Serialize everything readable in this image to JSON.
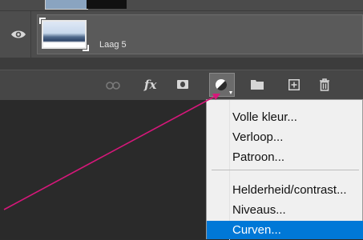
{
  "layer": {
    "name": "Laag 5"
  },
  "toolbar": {
    "icons": [
      "link-icon",
      "fx-icon",
      "mask-icon",
      "adjustment-layer-icon",
      "folder-icon",
      "new-layer-icon",
      "trash-icon"
    ],
    "fx_label": "fx"
  },
  "menu": {
    "items": [
      {
        "label": "Volle kleur...",
        "active": false
      },
      {
        "label": "Verloop...",
        "active": false
      },
      {
        "label": "Patroon...",
        "active": false
      },
      {
        "label": "Helderheid/contrast...",
        "active": false
      },
      {
        "label": "Niveaus...",
        "active": false
      },
      {
        "label": "Curven...",
        "active": true
      }
    ]
  },
  "colors": {
    "arrow": "#d6177a",
    "highlight": "#0078d7"
  }
}
